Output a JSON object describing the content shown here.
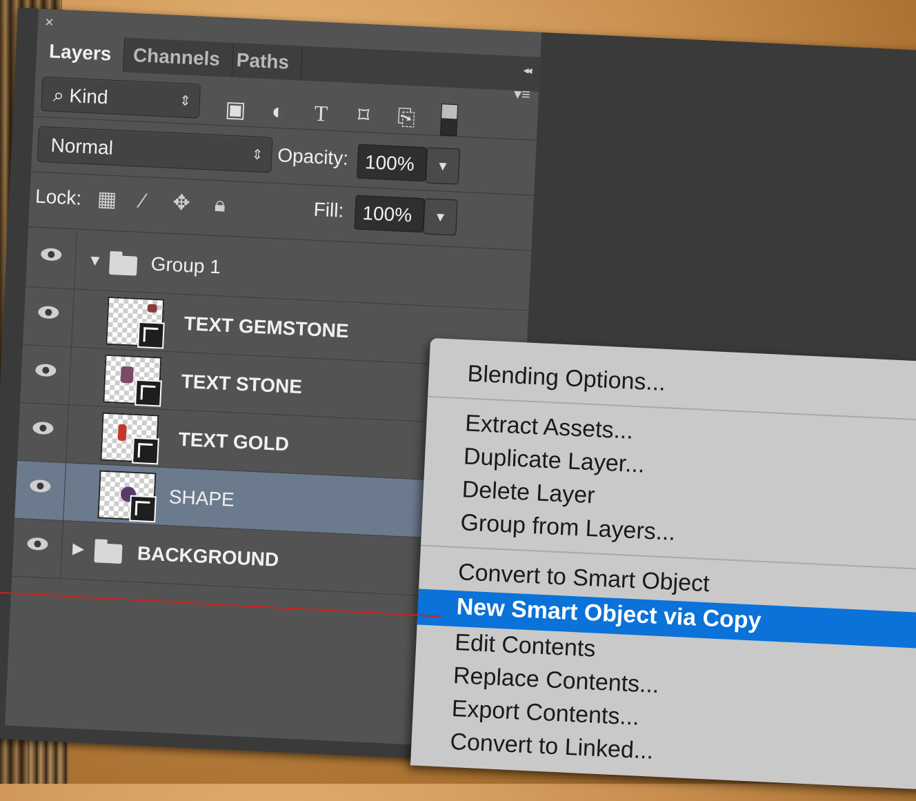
{
  "panel": {
    "close": "×",
    "tabs": [
      "Layers",
      "Channels",
      "Paths"
    ],
    "collapse": "◂◂",
    "menu": "▾≡"
  },
  "filter": {
    "kind_label": "⌕ Kind",
    "icons": [
      "image-filter-icon",
      "adjustment-filter-icon",
      "type-filter-icon",
      "shape-filter-icon",
      "smart-object-filter-icon",
      "filter-toggle"
    ]
  },
  "blend": {
    "mode": "Normal",
    "opacity_label": "Opacity:",
    "opacity_value": "100%"
  },
  "lock": {
    "label": "Lock:",
    "fill_label": "Fill:",
    "fill_value": "100%"
  },
  "layers": [
    {
      "name": "Group 1",
      "type": "group",
      "expanded": true
    },
    {
      "name": "TEXT GEMSTONE",
      "type": "smart"
    },
    {
      "name": "TEXT STONE",
      "type": "smart"
    },
    {
      "name": "TEXT GOLD",
      "type": "smart"
    },
    {
      "name": "SHAPE",
      "type": "smart",
      "selected": true
    },
    {
      "name": "BACKGROUND",
      "type": "group",
      "expanded": false
    }
  ],
  "context_menu": {
    "items": [
      "Blending Options...",
      "Extract Assets...",
      "Duplicate Layer...",
      "Delete Layer",
      "Group from Layers...",
      "Convert to Smart Object",
      "New Smart Object via Copy",
      "Edit Contents",
      "Replace Contents...",
      "Export Contents...",
      "Convert to Linked..."
    ],
    "highlighted": "New Smart Object via Copy"
  },
  "colors": {
    "highlight": "#0a72d8",
    "selected_layer": "#6c7a8e",
    "pointer_line": "#d0201a"
  }
}
